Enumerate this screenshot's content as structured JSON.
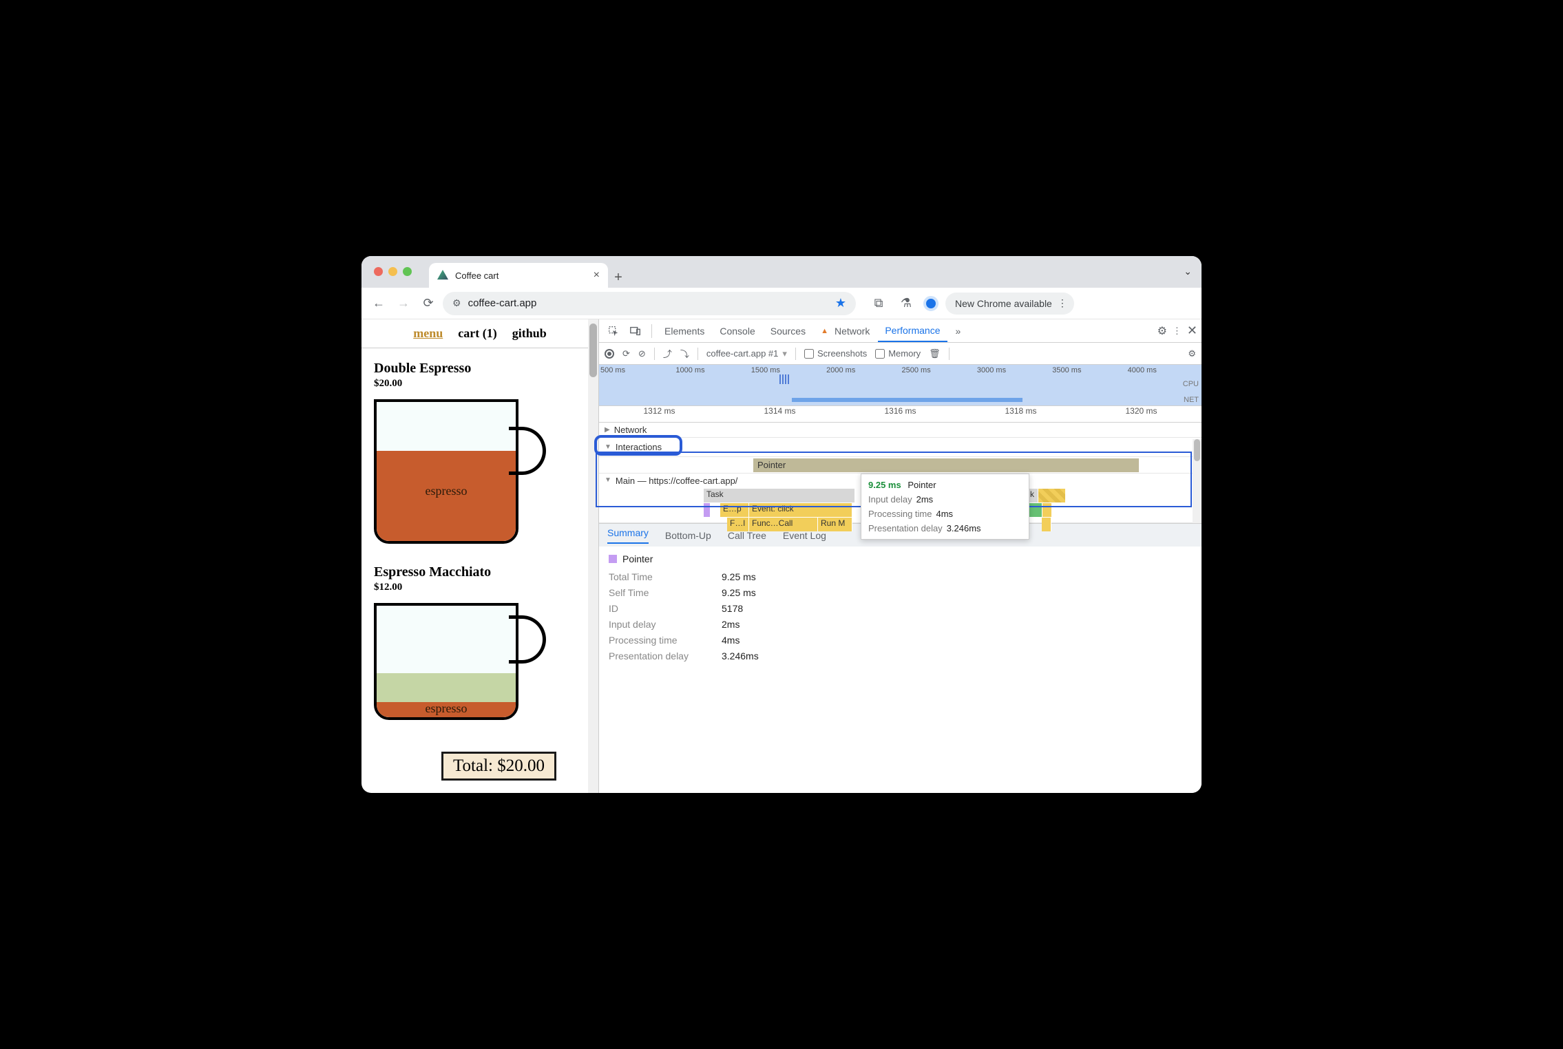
{
  "browser": {
    "tab_title": "Coffee cart",
    "url": "coffee-cart.app",
    "new_chrome": "New Chrome available"
  },
  "page": {
    "nav": {
      "menu": "menu",
      "cart": "cart (1)",
      "github": "github"
    },
    "products": [
      {
        "name": "Double Espresso",
        "price": "$20.00",
        "label": "espresso"
      },
      {
        "name": "Espresso Macchiato",
        "price": "$12.00",
        "label": "espresso"
      }
    ],
    "total": "Total: $20.00"
  },
  "devtools": {
    "tabs": [
      "Elements",
      "Console",
      "Sources",
      "Network",
      "Performance"
    ],
    "active_tab": "Performance",
    "perf_toolbar": {
      "target": "coffee-cart.app #1",
      "screenshots": "Screenshots",
      "memory": "Memory"
    },
    "overview_ticks": [
      "500 ms",
      "1000 ms",
      "1500 ms",
      "2000 ms",
      "2500 ms",
      "3000 ms",
      "3500 ms",
      "4000 ms"
    ],
    "overview_labels": {
      "cpu": "CPU",
      "net": "NET"
    },
    "ruler": [
      "1312 ms",
      "1314 ms",
      "1316 ms",
      "1318 ms",
      "1320 ms"
    ],
    "tracks": {
      "network": "Network",
      "interactions": "Interactions",
      "pointer": "Pointer",
      "main": "Main — https://coffee-cart.app/"
    },
    "flame": {
      "task": "Task",
      "task2_short": "k",
      "ep": "E…p",
      "event_click": "Event: click",
      "fi": "F…l",
      "func_call": "Func…Call",
      "runm": "Run M"
    },
    "tooltip": {
      "time": "9.25 ms",
      "name": "Pointer",
      "rows": [
        {
          "k": "Input delay",
          "v": "2ms"
        },
        {
          "k": "Processing time",
          "v": "4ms"
        },
        {
          "k": "Presentation delay",
          "v": "3.246ms"
        }
      ]
    },
    "bottom_tabs": [
      "Summary",
      "Bottom-Up",
      "Call Tree",
      "Event Log"
    ],
    "summary": {
      "title": "Pointer",
      "rows": [
        {
          "k": "Total Time",
          "v": "9.25 ms"
        },
        {
          "k": "Self Time",
          "v": "9.25 ms"
        },
        {
          "k": "ID",
          "v": "5178"
        },
        {
          "k": "Input delay",
          "v": "2ms"
        },
        {
          "k": "Processing time",
          "v": "4ms"
        },
        {
          "k": "Presentation delay",
          "v": "3.246ms"
        }
      ]
    }
  }
}
